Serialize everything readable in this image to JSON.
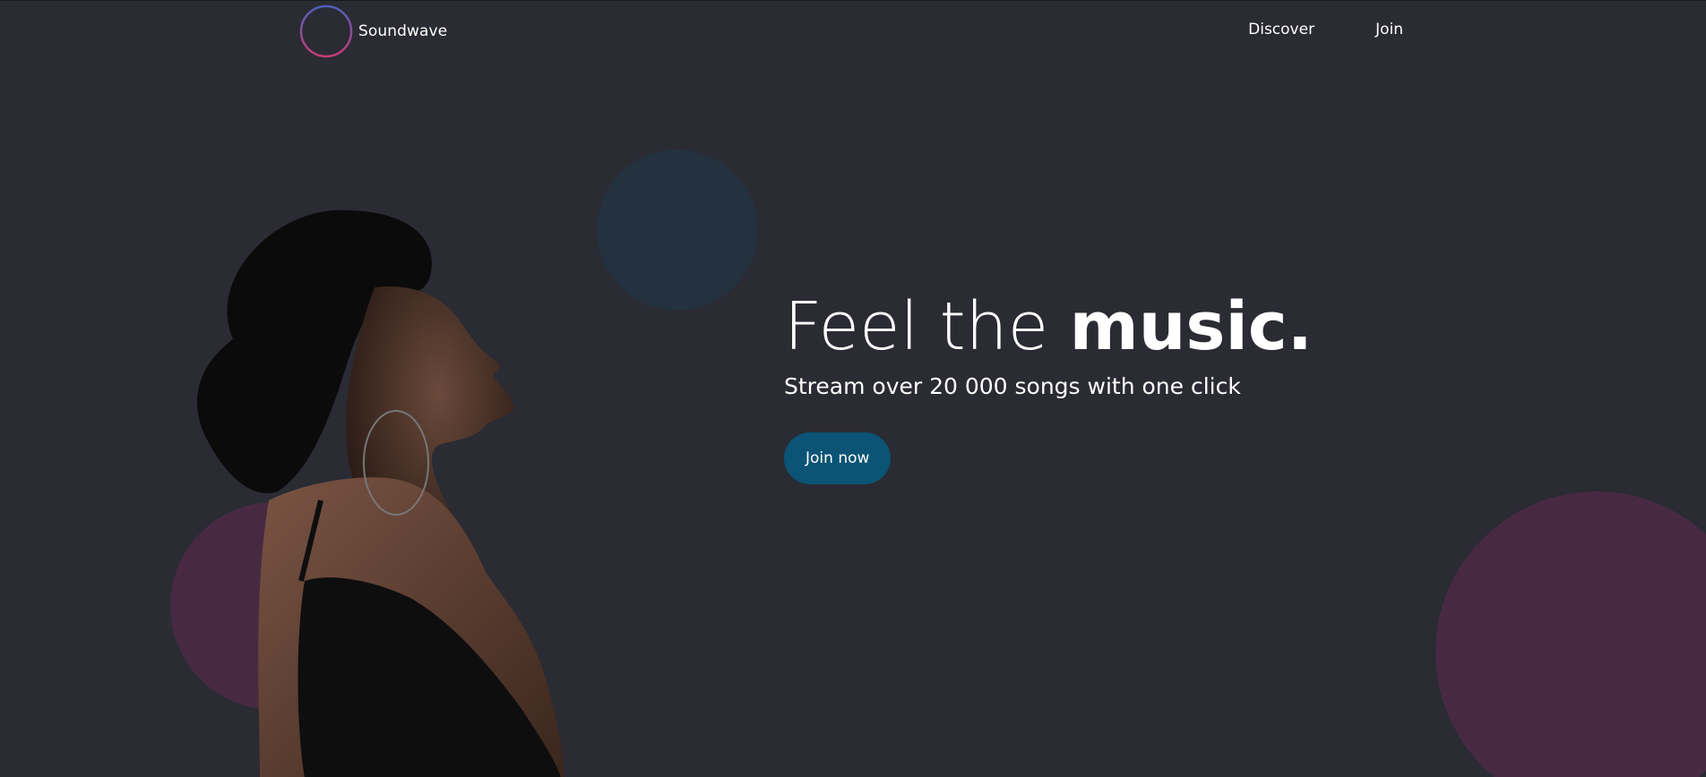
{
  "brand": {
    "name": "Soundwave",
    "logo_icon": "soundwave-logo-icon",
    "logo_gradient": [
      "#4f5fb8",
      "#c73b76"
    ]
  },
  "nav": {
    "items": [
      {
        "label": "Discover"
      },
      {
        "label": "Join"
      }
    ]
  },
  "hero": {
    "title_light": "Feel the ",
    "title_bold": "music.",
    "subtitle": "Stream over 20 000 songs with one click",
    "cta_label": "Join now"
  },
  "colors": {
    "background": "#2a2b33",
    "teal_circle": "#24313f",
    "plum_circle": "#472a42",
    "cta": "#0b5475",
    "text": "#ffffff"
  }
}
